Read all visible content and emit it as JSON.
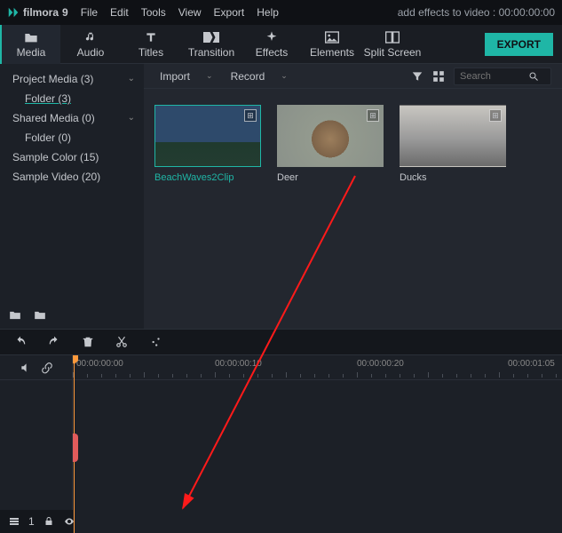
{
  "app": {
    "name": "filmora",
    "version": "9"
  },
  "title_right": "add effects to video : 00:00:00:00",
  "menu": [
    "File",
    "Edit",
    "Tools",
    "View",
    "Export",
    "Help"
  ],
  "tabs": [
    {
      "label": "Media",
      "icon": "folder"
    },
    {
      "label": "Audio",
      "icon": "music"
    },
    {
      "label": "Titles",
      "icon": "text"
    },
    {
      "label": "Transition",
      "icon": "transition"
    },
    {
      "label": "Effects",
      "icon": "sparkle"
    },
    {
      "label": "Elements",
      "icon": "image"
    },
    {
      "label": "Split Screen",
      "icon": "split"
    }
  ],
  "export_label": "EXPORT",
  "sidebar": {
    "items": [
      {
        "label": "Project Media (3)",
        "expandable": true
      },
      {
        "label": "Folder (3)",
        "link": true,
        "child": true
      },
      {
        "label": "Shared Media (0)",
        "expandable": true
      },
      {
        "label": "Folder (0)",
        "child": true
      },
      {
        "label": "Sample Color (15)"
      },
      {
        "label": "Sample Video (20)"
      }
    ]
  },
  "media_bar": {
    "import": "Import",
    "record": "Record",
    "search_placeholder": "Search"
  },
  "clips": [
    {
      "label": "BeachWaves2Clip",
      "cls": "beach",
      "selected": true
    },
    {
      "label": "Deer",
      "cls": "deer"
    },
    {
      "label": "Ducks",
      "cls": "ducks"
    }
  ],
  "ruler": [
    "00:00:00:00",
    "00:00:00:10",
    "00:00:00:20",
    "00:00:01:05"
  ],
  "timeline_footer": {
    "track_count": "1"
  }
}
